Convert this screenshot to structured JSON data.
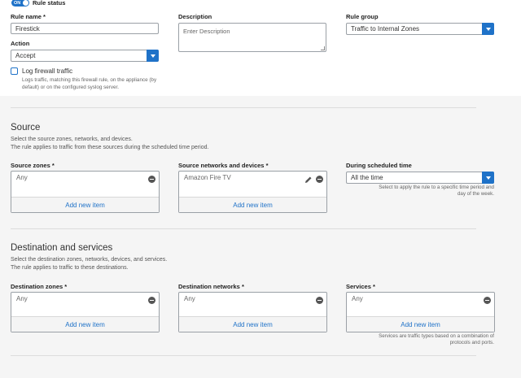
{
  "rule_status": {
    "toggle": "ON",
    "label": "Rule status"
  },
  "rule_name": {
    "label": "Rule name",
    "value": "Firestick"
  },
  "description": {
    "label": "Description",
    "placeholder": "Enter Description"
  },
  "rule_group": {
    "label": "Rule group",
    "value": "Traffic to Internal Zones"
  },
  "action": {
    "label": "Action",
    "value": "Accept"
  },
  "log": {
    "label": "Log firewall traffic",
    "desc_line1": "Logs traffic, matching this firewall rule, on the appliance (by",
    "desc_line2": "default) or on the configured syslog server."
  },
  "source": {
    "title": "Source",
    "desc_line1": "Select the source zones, networks, and devices.",
    "desc_line2": "The rule applies to traffic from these sources during the scheduled time period.",
    "zones": {
      "label": "Source zones",
      "item": "Any",
      "add": "Add new item"
    },
    "networks": {
      "label": "Source networks and devices",
      "item": "Amazon Fire TV",
      "add": "Add new item"
    },
    "schedule": {
      "label": "During scheduled time",
      "value": "All the time",
      "hint_line1": "Select to apply the rule to a specific time period and",
      "hint_line2": "day of the week."
    }
  },
  "destination": {
    "title": "Destination and services",
    "desc_line1": "Select the destination zones, networks, devices, and services.",
    "desc_line2": "The rule applies to traffic to these destinations.",
    "zones": {
      "label": "Destination zones",
      "item": "Any",
      "add": "Add new item"
    },
    "networks": {
      "label": "Destination networks",
      "item": "Any",
      "add": "Add new item"
    },
    "services": {
      "label": "Services",
      "item": "Any",
      "add": "Add new item",
      "hint_line1": "Services are traffic types based on a combination of",
      "hint_line2": "protocols and ports."
    }
  },
  "required_mark": "*",
  "colors": {
    "accent": "#1f72c8",
    "background": "#f0f0f0"
  },
  "icons": {
    "remove": "minus-circle-icon",
    "edit": "pencil-icon",
    "dropdown": "chevron-down-icon"
  }
}
